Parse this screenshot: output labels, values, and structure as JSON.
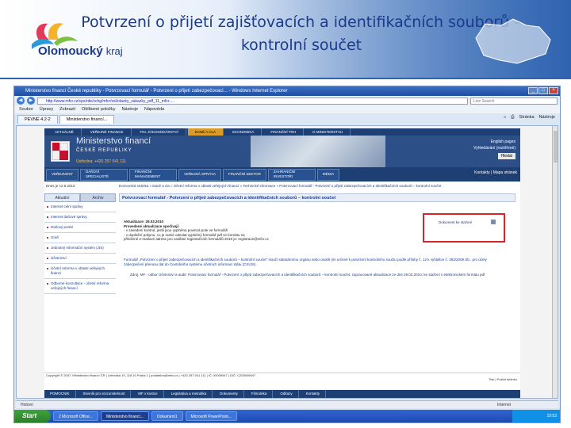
{
  "slide": {
    "title_line1": "Potvrzení o přijetí zajišťovacích a identifikačních souborů –",
    "title_line2": "kontrolní součet",
    "logo_name": "Olomoucký",
    "logo_suffix": "kraj"
  },
  "browser": {
    "window_title": "Ministerstvo financí České republiky - Potvrzovací formulář - Potvrzení o přijetí zabezpečovací... - Windows Internet Explorer",
    "address": "http://www.mfcr.cz/cps/rde/xchg/mfcr/xsl/otazky_zakazky_pdf_11_mfcr.....",
    "search_placeholder": "Live Search",
    "menu": [
      "Soubor",
      "Úpravy",
      "Zobrazit",
      "Oblíbené položky",
      "Nástroje",
      "Nápověda"
    ],
    "tabs": [
      {
        "label": "PEVNÉ 4.2-2"
      },
      {
        "label": "Ministerstvo financí..."
      }
    ],
    "tools": [
      "Stránka",
      "Nástroje"
    ],
    "status_text": "Hotovo",
    "zone_text": "Internet"
  },
  "site": {
    "topnav": [
      "AKTUÁLNĚ",
      "VEŘEJNÉ FINANCE",
      "FIN. ZÁKONODÁRSTVÍ",
      "DANĚ A CLA",
      "EKONOMIKA",
      "FINANČNÍ TRH",
      "O MINISTERSTVU"
    ],
    "ministry_name": "Ministerstvo financí",
    "ministry_sub": "ČESKÉ REPUBLIKY",
    "ministry_phone": "Ústředna: +420 257 041 111",
    "english_link": "English pages",
    "search_label": "Vyhledávání (rozšířené)",
    "search_button": "Hledat",
    "secnav": [
      "VEŘEJNOST",
      "DAŇOVÍ SPECIALISTÉ",
      "FINANČNÍ MANAGEMENT",
      "VEŘEJNÁ SPRÁVA",
      "FINANČNÍ SEKTOR",
      "ZAHRANIČNÍ INVESTOŘI",
      "MÉDIA"
    ],
    "contacts": "Kontakty | Mapa stránek",
    "date": "Dnes je 12.5.2010",
    "breadcrumb": "Domovská stránka » Daně a cla » Účetní reforma v oblasti veřejných financí » Technické informace » Potvrzovací formulář - Potvrzení o přijetí zabezpečovacích a identifikačních souborů – kontrolní součet",
    "side_tabs": [
      "Aktuální",
      "Archiv"
    ],
    "side_items": [
      "Internet celní správy",
      "Internet daňové správy",
      "Daňový portál",
      "Izraři",
      "Jednotný informační systém (JIS)",
      "Účetnictví",
      "Účetní reforma v oblasti veřejných financí",
      "Odborné konzultace - účetní reforma veřejných financí"
    ],
    "main_title": "Potvrzovací formulář - Potvrzení o přijetí zabezpečovacích a identifikačních souborů – kontrolní součet",
    "update_label": "Aktualizace: 29.03.2010",
    "update_text1": "Provedené aktualizace spočívají:",
    "update_text2": "- v zavedení kontrol, jestli jsou vyplněna povinná pole ve formuláři",
    "update_text3": "- v doplnění pokynu, co je nutné odeslat vyplněný formulář pdf ve formátu na",
    "update_text4": "přiložené e-mailové adrese pro zasílání registračních formulářů 2010 je: registrace@mfcr.cz",
    "download_text": "Dokument ke stažení",
    "paragraph": "Formulář „Potvrzení o přijetí zabezpečovacích a identifikačních souborů – kontrolní součet“ slouží statutárnímu orgánu nebo osobě jím určené k potvrzení kontrolního součtu podle přílohy č. 12 k vyhlášce č. 383/2009 Sb., pro účely zabezpečení přenosu dat do Centrálního systému účetních informací státu (CSÚIS).",
    "paragraph2": "Zdroj: MF - odbor Účetnictví a audit: Potvrzovací formulář - Potvrzení o přijetí zabezpečovacích a identifikačních souborů – kontrolní součet, zapracované aktualizace ze dne 29.03.2010, ke stažení v elektronickém formátu pdf",
    "footer_text": "Copyright © 2007, Ministerstvo financí ČR | Letenská 15, 118 10 Praha 1 | podatelna@mfcr.cz | +420 257 041 111 | IČ: 00006947 | DIČ: CZ00006947",
    "print_link": "Tisk | Poslat stránku",
    "bottomnav": [
      "POMOCNÍK",
      "Slovník pro srozumitelnost",
      "MF v kostce",
      "Legislativa a metodika",
      "Dokumenty",
      "Filmotéka",
      "Odkazy",
      "Kontakty"
    ]
  },
  "taskbar": {
    "start": "Start",
    "tasks": [
      "2 Microsoft Office...",
      "Ministerstvo financí...",
      "Dokument1",
      "Microsoft PowerPoint..."
    ],
    "clock": "10:53"
  }
}
